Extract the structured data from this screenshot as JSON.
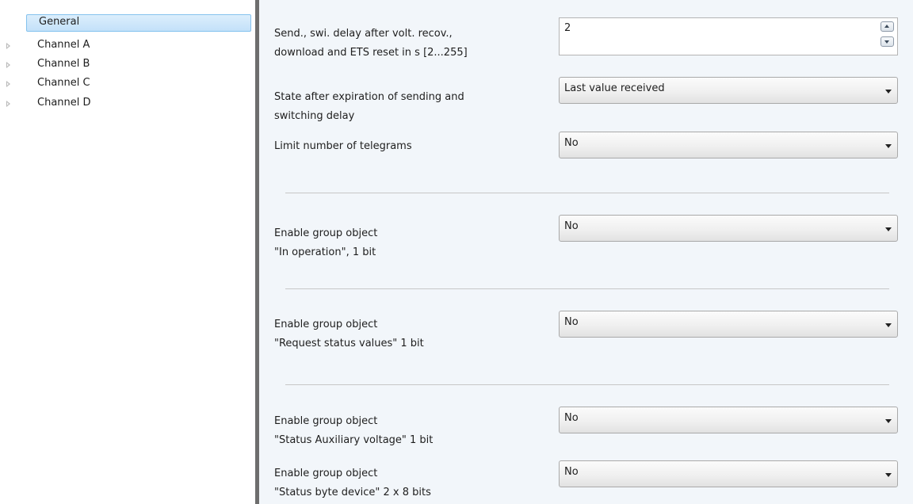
{
  "tree": {
    "items": [
      {
        "label": "General"
      },
      {
        "label": "Channel A"
      },
      {
        "label": "Channel B"
      },
      {
        "label": "Channel C"
      },
      {
        "label": "Channel D"
      }
    ]
  },
  "params": {
    "send_delay": {
      "label_line1": "Send., swi. delay after volt. recov.,",
      "label_line2": "download and ETS reset in s [2...255]",
      "value": "2"
    },
    "state_after_expiration": {
      "label_line1": "State after expiration of sending and",
      "label_line2": "switching delay",
      "value": "Last value received"
    },
    "limit_telegrams": {
      "label_line1": "Limit number of telegrams",
      "value": "No"
    },
    "in_operation": {
      "label_line1": "Enable group object",
      "label_line2": "\"In operation\", 1 bit",
      "value": "No"
    },
    "request_status": {
      "label_line1": "Enable group object",
      "label_line2": "\"Request status values\" 1 bit",
      "value": "No"
    },
    "status_aux_voltage": {
      "label_line1": "Enable group object",
      "label_line2": "\"Status Auxiliary voltage\" 1 bit",
      "value": "No"
    },
    "status_byte": {
      "label_line1": "Enable group object",
      "label_line2": "\"Status byte device\" 2 x 8 bits",
      "value": "No"
    }
  }
}
